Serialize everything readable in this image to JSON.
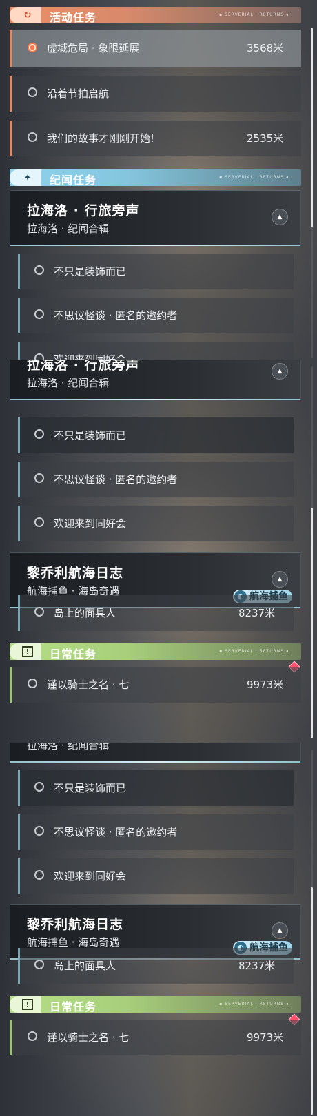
{
  "categories": {
    "activity": {
      "label": "活动任务",
      "icon": "refresh-arrow-icon",
      "deco": "▪ SERVERIAL · RETURNS ◂",
      "color": "#e98e66"
    },
    "legend": {
      "label": "纪闻任务",
      "icon": "star-sparkle-icon",
      "deco": "▪ SERVERIAL · RETURNS ◂",
      "color": "#8fd2ec"
    },
    "daily": {
      "label": "日常任务",
      "icon": "exclamation-box-icon",
      "deco": "▪ SERVERIAL · RETURNS ◂",
      "color": "#b5dd85"
    }
  },
  "activity_quests": [
    {
      "name": "虚域危局 · 象限延展",
      "distance": "3568米",
      "selected": true
    },
    {
      "name": "沿着节拍启航",
      "distance": ""
    },
    {
      "name": "我们的故事才刚刚开始!",
      "distance": "2535米"
    }
  ],
  "lahailuo": {
    "title": "拉海洛 · 行旅旁声",
    "subtitle": "拉海洛 · 纪闻合辑",
    "quests": [
      {
        "name": "不只是装饰而已"
      },
      {
        "name": "不思议怪谈 · 匿名的邀约者"
      },
      {
        "name": "欢迎来到同好会"
      }
    ]
  },
  "liqiaoli": {
    "title": "黎乔利航海日志",
    "subtitle": "航海捕鱼 · 海岛奇遇",
    "badge": "航海捕鱼",
    "quests": [
      {
        "name": "岛上的面具人",
        "distance": "8237米"
      }
    ]
  },
  "daily_quests": [
    {
      "name": "谨以骑士之名 · 七",
      "distance": "9973米"
    }
  ],
  "icons": {
    "collapse": "chevron-up-icon",
    "radio": "radio-circle-icon",
    "badge_icon": "fish-icon",
    "alert": "red-diamond-icon"
  }
}
